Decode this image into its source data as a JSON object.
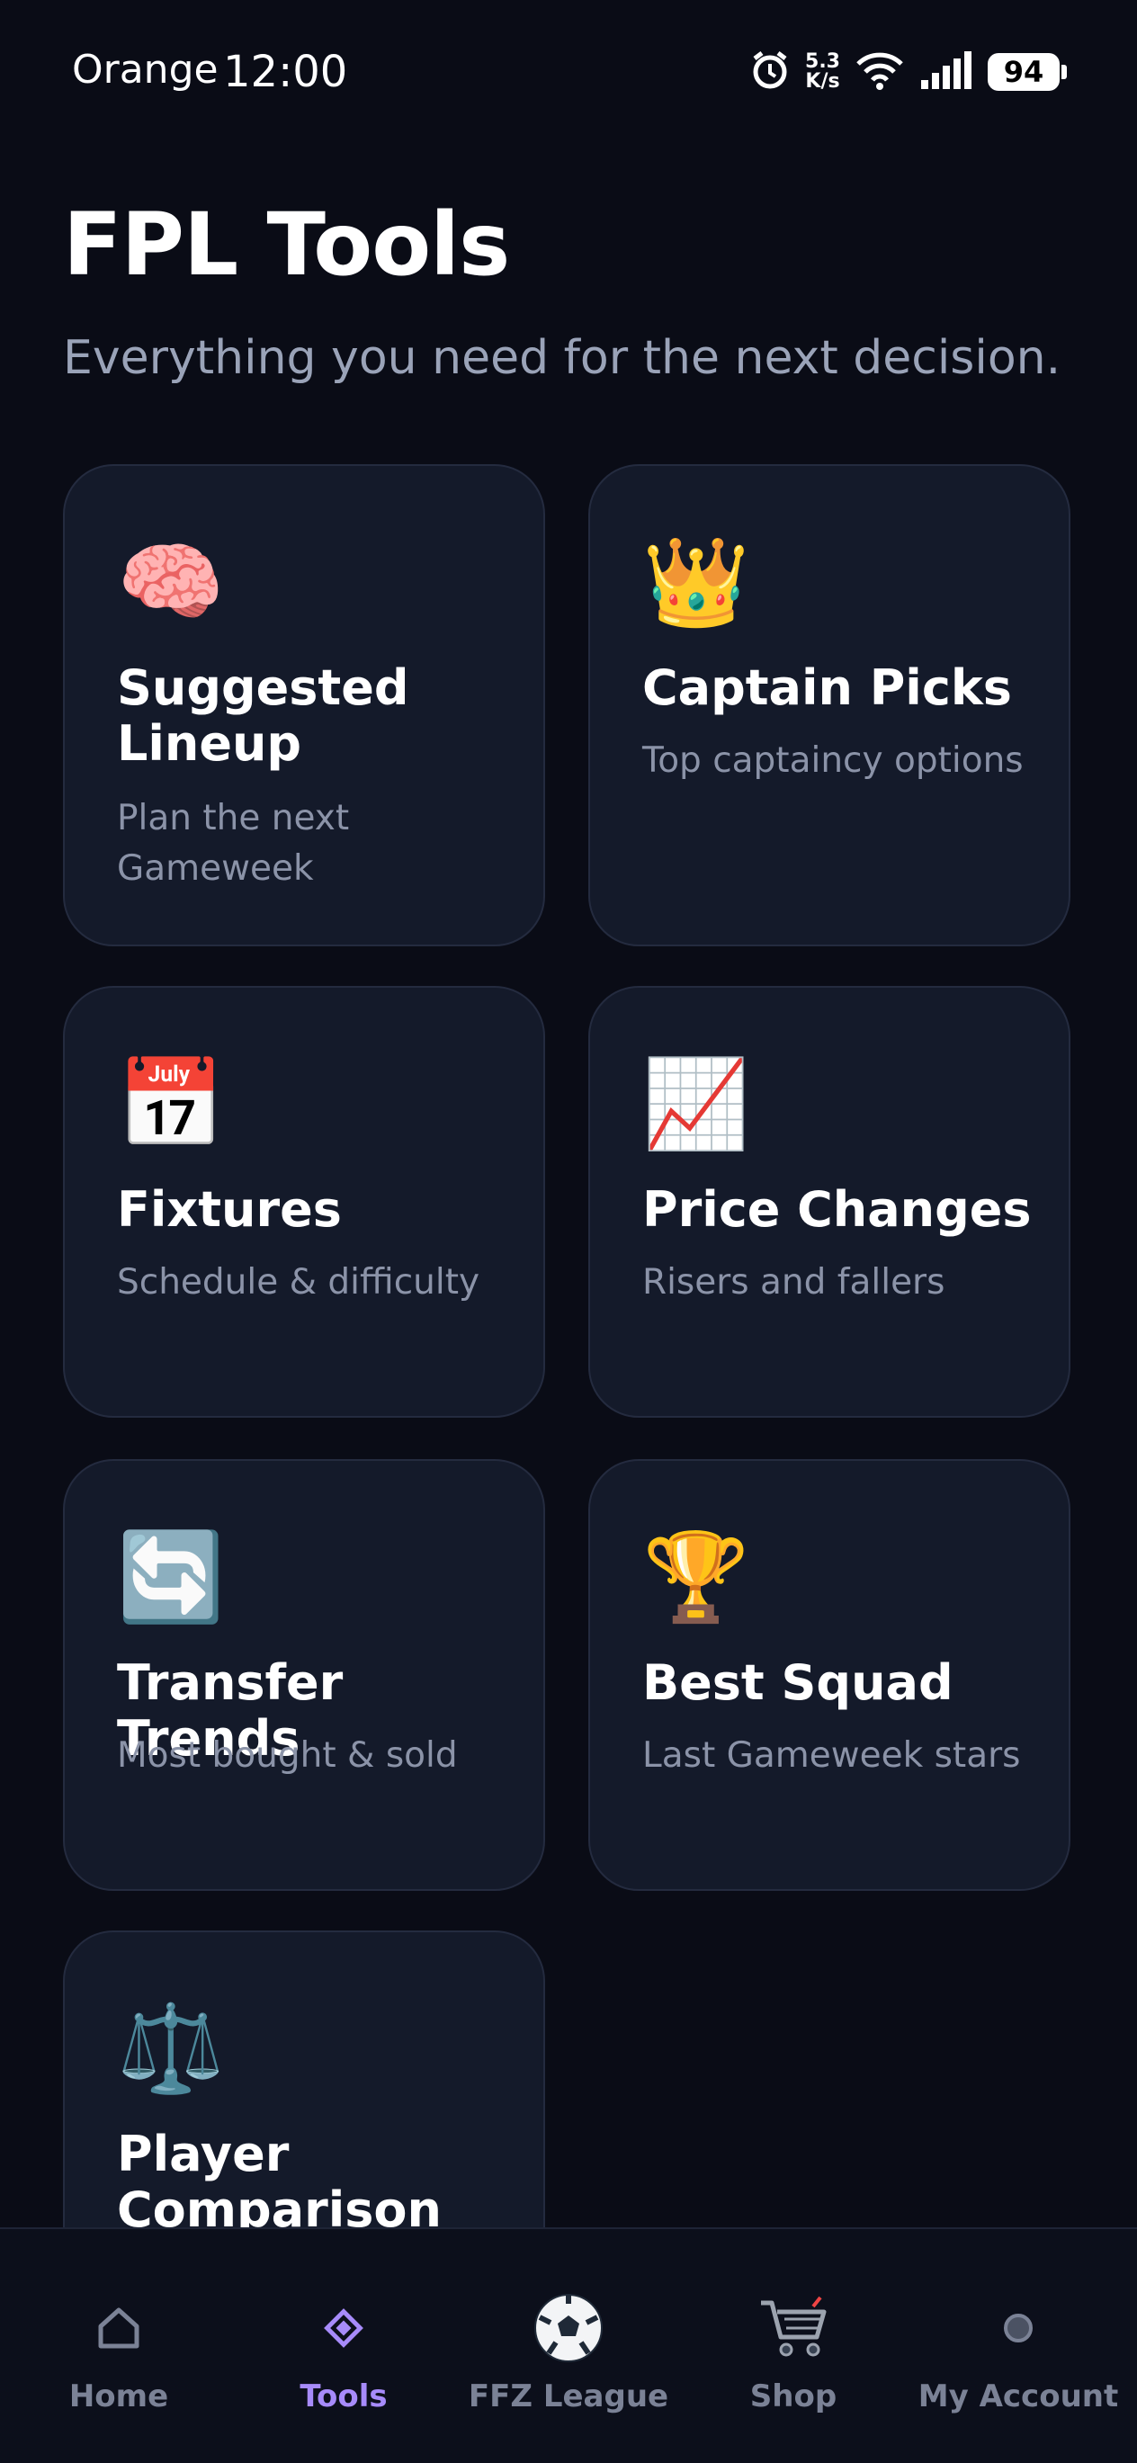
{
  "status_bar": {
    "carrier": "Orange",
    "time": "12:00",
    "speed_value": "5.3",
    "speed_unit": "K/s",
    "battery": "94"
  },
  "header": {
    "title": "FPL Tools",
    "subtitle": "Everything you need for the next decision."
  },
  "tools": [
    {
      "icon": "brain-icon",
      "emoji": "🧠",
      "title": "Suggested Lineup",
      "desc": "Plan the next Gameweek"
    },
    {
      "icon": "crown-icon",
      "emoji": "👑",
      "title": "Captain Picks",
      "desc": "Top captaincy options"
    },
    {
      "icon": "calendar-icon",
      "emoji": "📅",
      "title": "Fixtures",
      "desc": "Schedule & difficulty"
    },
    {
      "icon": "chart-increasing-icon",
      "emoji": "📈",
      "title": "Price Changes",
      "desc": "Risers and fallers"
    },
    {
      "icon": "repeat-icon",
      "emoji": "🔄",
      "title": "Transfer Trends",
      "desc": "Most bought & sold"
    },
    {
      "icon": "trophy-icon",
      "emoji": "🏆",
      "title": "Best Squad",
      "desc": "Last Gameweek stars"
    },
    {
      "icon": "balance-scale-icon",
      "emoji": "⚖️",
      "title": "Player Comparison",
      "desc": ""
    }
  ],
  "nav": {
    "active": "Tools",
    "items": [
      {
        "label": "Home",
        "icon": "home-icon"
      },
      {
        "label": "Tools",
        "icon": "diamond-icon"
      },
      {
        "label": "FFZ League",
        "icon": "soccer-ball-icon"
      },
      {
        "label": "Shop",
        "icon": "cart-icon"
      },
      {
        "label": "My Account",
        "icon": "account-icon"
      }
    ]
  },
  "colors": {
    "background": "#0a0c16",
    "card": "#141a2a",
    "accent": "#a78bfa",
    "muted": "#8b93a8"
  }
}
